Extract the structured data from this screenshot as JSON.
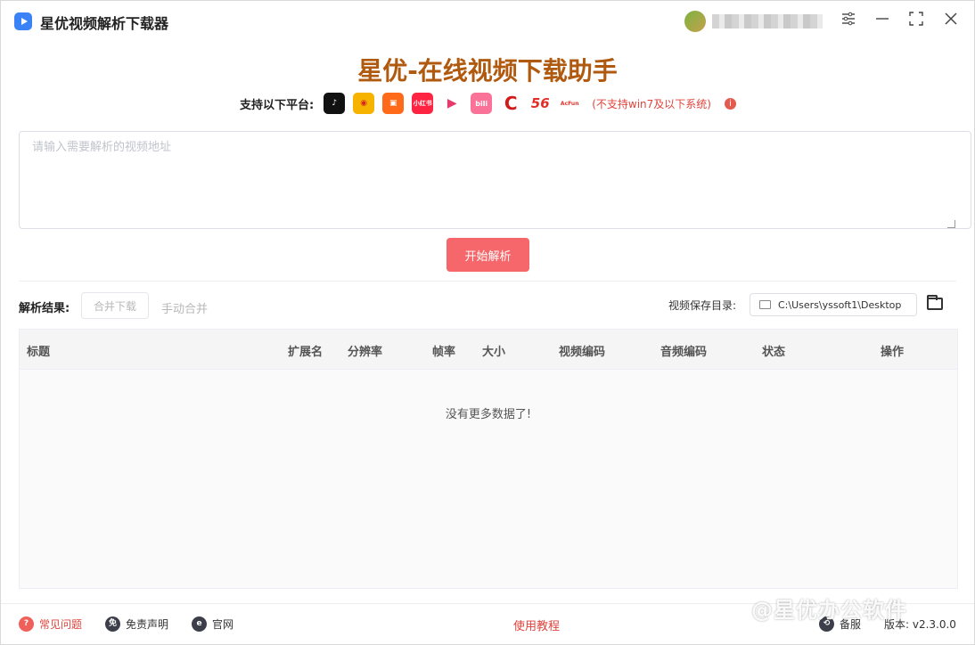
{
  "app": {
    "title": "星优视频解析下载器",
    "window_controls": [
      "settings-icon",
      "minimize-icon",
      "maximize-icon",
      "close-icon"
    ]
  },
  "header": {
    "main_title": "星优-在线视频下载助手",
    "platforms_label": "支持以下平台:",
    "platforms": [
      {
        "name": "douyin",
        "glyph": "♪",
        "color": "#111111"
      },
      {
        "name": "weibo",
        "glyph": "◉",
        "color": "#f6b400"
      },
      {
        "name": "kuaishou",
        "glyph": "▣",
        "color": "#ff6a1a"
      },
      {
        "name": "xiaohongshu",
        "glyph": "小红书",
        "color": "#ff2442"
      },
      {
        "name": "youku",
        "glyph": "▶",
        "color": "#ffffff"
      },
      {
        "name": "bilibili",
        "glyph": "bili",
        "color": "#fb7299"
      },
      {
        "name": "cctv",
        "glyph": "C",
        "color": "#ffffff"
      },
      {
        "name": "56",
        "glyph": "56",
        "color": "#ffffff"
      },
      {
        "name": "acfun",
        "glyph": "AcFun",
        "color": "#ffffff"
      }
    ],
    "note": "(不支持win7及以下系统)"
  },
  "input": {
    "placeholder": "请输入需要解析的视频地址",
    "value": ""
  },
  "parse_button": "开始解析",
  "results": {
    "label": "解析结果:",
    "merge_download": "合并下载",
    "manual_merge": "手动合并",
    "save_dir_label": "视频保存目录:",
    "save_dir": "C:\\Users\\yssoft1\\Desktop"
  },
  "table": {
    "columns": [
      "标题",
      "扩展名",
      "分辨率",
      "帧率",
      "大小",
      "视频编码",
      "音频编码",
      "状态",
      "操作"
    ],
    "rows": [],
    "empty_text": "没有更多数据了!"
  },
  "footer": {
    "faq": "常见问题",
    "disclaimer": "免责声明",
    "website": "官网",
    "tutorial": "使用教程",
    "backup": "备服",
    "version": "版本: v2.3.0.0"
  },
  "watermark": "@星优办公软件",
  "colors": {
    "accent": "#f5676a",
    "title": "#b05a10",
    "warning": "#e0433b"
  }
}
